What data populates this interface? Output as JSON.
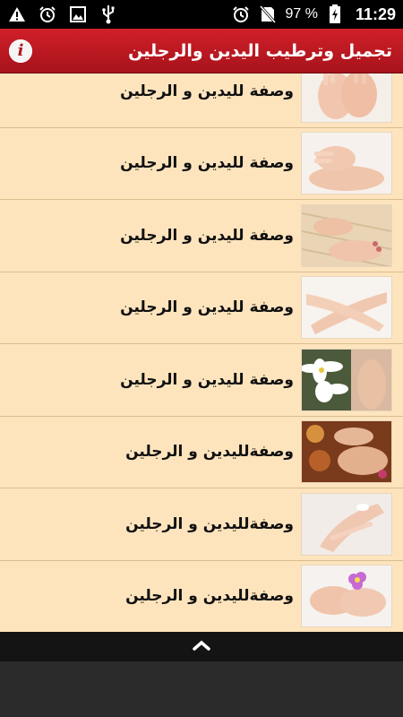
{
  "status_bar": {
    "battery_text": "97 %",
    "time": "11:29",
    "left_icons": [
      "warning-icon",
      "alarm-icon",
      "image-icon",
      "usb-icon"
    ],
    "right_icons": [
      "alarm-icon",
      "no-sim-icon",
      "battery-charging-icon"
    ]
  },
  "app_bar": {
    "title": "تجميل وترطيب اليدين والرجلين",
    "info_icon_glyph": "i",
    "color": "#c0161f"
  },
  "list": {
    "background": "#fde4bd",
    "items": [
      {
        "label": "وصفة لليدين و الرجلين",
        "thumb": "hands-icon"
      },
      {
        "label": "وصفة لليدين و الرجلين",
        "thumb": "hand-on-foot-icon"
      },
      {
        "label": "وصفة لليدين و الرجلين",
        "thumb": "spa-feet-icon"
      },
      {
        "label": "وصفة لليدين و الرجلين",
        "thumb": "crossed-hands-icon"
      },
      {
        "label": "وصفة لليدين و الرجلين",
        "thumb": "lily-feet-icon"
      },
      {
        "label": "وصفةلليدين و الرجلين",
        "thumb": "candle-spa-icon"
      },
      {
        "label": "وصفةلليدين و الرجلين",
        "thumb": "cream-hand-icon"
      },
      {
        "label": "وصفةلليدين و الرجلين",
        "thumb": "orchid-hands-icon"
      }
    ]
  },
  "bottom_bar": {
    "icon": "chevron-up-icon"
  }
}
